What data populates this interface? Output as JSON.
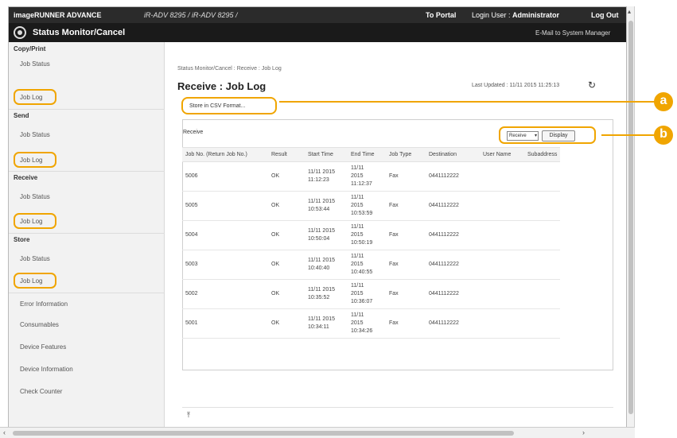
{
  "topbar": {
    "brand": "imageRUNNER ADVANCE",
    "device": "iR-ADV 8295 / iR-ADV 8295 /",
    "to_portal": "To Portal",
    "login_label": "Login User :",
    "login_user": "Administrator",
    "logout": "Log Out"
  },
  "titlebar": {
    "title": "Status Monitor/Cancel",
    "email_link": "E-Mail to System Manager"
  },
  "sidebar": {
    "copy_print": "Copy/Print",
    "copy_job_status": "Job Status",
    "copy_job_log": "Job Log",
    "send": "Send",
    "send_job_status": "Job Status",
    "send_job_log": "Job Log",
    "receive": "Receive",
    "receive_job_status": "Job Status",
    "receive_job_log": "Job Log",
    "store": "Store",
    "store_job_status": "Job Status",
    "store_job_log": "Job Log",
    "error_information": "Error Information",
    "consumables": "Consumables",
    "device_features": "Device Features",
    "device_information": "Device Information",
    "check_counter": "Check Counter"
  },
  "main": {
    "breadcrumb": "Status Monitor/Cancel : Receive : Job Log",
    "title": "Receive : Job Log",
    "last_updated": "Last Updated : 11/11 2015 11:25:13",
    "store_csv": "Store in CSV Format...",
    "section_label": "Receive",
    "filter_value": "Receive",
    "display_button": "Display"
  },
  "table": {
    "headers": [
      "Job No. (Return Job No.)",
      "Result",
      "Start Time",
      "End Time",
      "Job Type",
      "Destination",
      "User Name",
      "Subaddress"
    ],
    "rows": [
      {
        "job": "5006",
        "result": "OK",
        "start1": "11/11 2015",
        "start2": "11:12:23",
        "end1": "11/11",
        "end2": "2015",
        "end3": "11:12:37",
        "type": "Fax",
        "dest": "0441112222"
      },
      {
        "job": "5005",
        "result": "OK",
        "start1": "11/11 2015",
        "start2": "10:53:44",
        "end1": "11/11",
        "end2": "2015",
        "end3": "10:53:59",
        "type": "Fax",
        "dest": "0441112222"
      },
      {
        "job": "5004",
        "result": "OK",
        "start1": "11/11 2015",
        "start2": "10:50:04",
        "end1": "11/11",
        "end2": "2015",
        "end3": "10:50:19",
        "type": "Fax",
        "dest": "0441112222"
      },
      {
        "job": "5003",
        "result": "OK",
        "start1": "11/11 2015",
        "start2": "10:40:40",
        "end1": "11/11",
        "end2": "2015",
        "end3": "10:40:55",
        "type": "Fax",
        "dest": "0441112222"
      },
      {
        "job": "5002",
        "result": "OK",
        "start1": "11/11 2015",
        "start2": "10:35:52",
        "end1": "11/11",
        "end2": "2015",
        "end3": "10:36:07",
        "type": "Fax",
        "dest": "0441112222"
      },
      {
        "job": "5001",
        "result": "OK",
        "start1": "11/11 2015",
        "start2": "10:34:11",
        "end1": "11/11",
        "end2": "2015",
        "end3": "10:34:26",
        "type": "Fax",
        "dest": "0441112222"
      }
    ]
  },
  "callouts": {
    "a": "a",
    "b": "b"
  },
  "colors": {
    "highlight": "#f0a500",
    "topbar": "#2b2b2b",
    "titlebar": "#1a1a1a"
  }
}
